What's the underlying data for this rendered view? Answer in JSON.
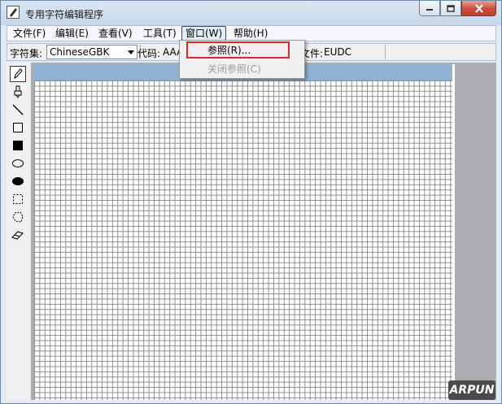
{
  "window": {
    "title": "专用字符编辑程序"
  },
  "menubar": {
    "items": [
      {
        "label": "文件(F)"
      },
      {
        "label": "编辑(E)"
      },
      {
        "label": "查看(V)"
      },
      {
        "label": "工具(T)"
      },
      {
        "label": "窗口(W)"
      },
      {
        "label": "帮助(H)"
      }
    ]
  },
  "infobar": {
    "charset_label": "字符集:",
    "charset_value": "ChineseGBK",
    "code_label": "代码:",
    "code_value": "AAA",
    "file_label": "文件:",
    "file_value": "EUDC"
  },
  "window_menu": {
    "items": [
      {
        "label": "参照(R)..."
      },
      {
        "label": "关闭参照(C)",
        "disabled": true
      }
    ]
  },
  "tools": [
    "pencil-icon",
    "brush-icon",
    "line-icon",
    "hollow-rectangle-icon",
    "filled-rectangle-icon",
    "hollow-ellipse-icon",
    "filled-ellipse-icon",
    "rectangle-select-icon",
    "freeform-select-icon",
    "eraser-icon"
  ],
  "highlight_color": "#e0262a",
  "watermark": "ARPUN"
}
